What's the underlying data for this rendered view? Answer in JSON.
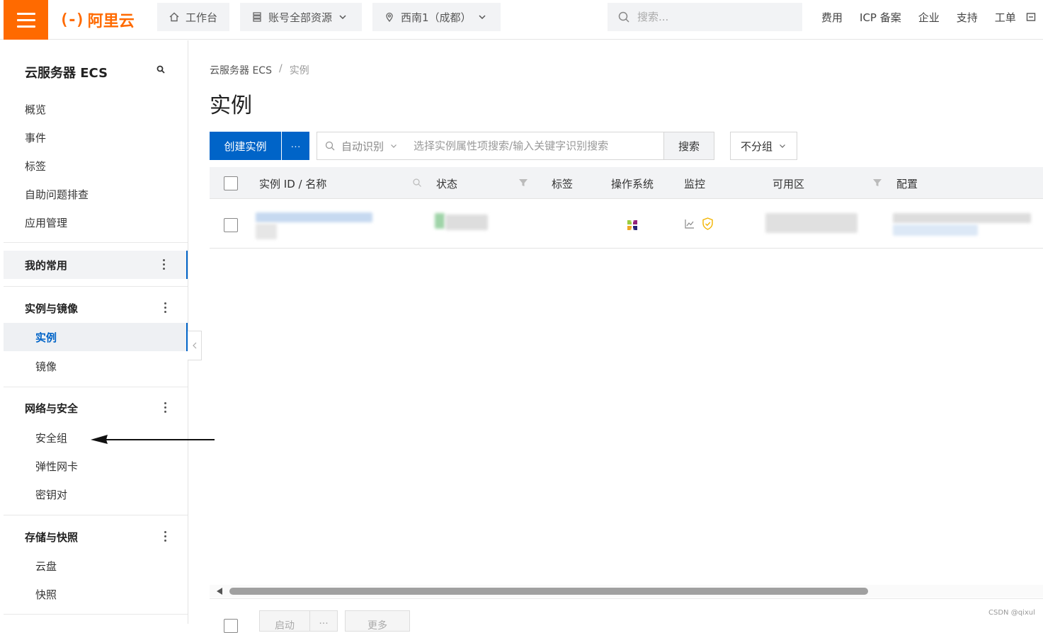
{
  "topbar": {
    "menu_icon": "hamburger-icon",
    "logo_mark": "(-)",
    "logo_text": "阿里云",
    "workbench": "工作台",
    "resources": "账号全部资源",
    "region": "西南1（成都）",
    "search_placeholder": "搜索...",
    "links": [
      "费用",
      "ICP 备案",
      "企业",
      "支持",
      "工单"
    ],
    "accent": "#ff6a00"
  },
  "sidebar": {
    "title": "云服务器 ECS",
    "top_items": [
      "概览",
      "事件",
      "标签",
      "自助问题排查",
      "应用管理"
    ],
    "favorites": "我的常用",
    "groups": {
      "instances_images": {
        "label": "实例与镜像",
        "items": [
          "实例",
          "镜像"
        ]
      },
      "network_security": {
        "label": "网络与安全",
        "items": [
          "安全组",
          "弹性网卡",
          "密钥对"
        ]
      },
      "storage_snapshots": {
        "label": "存储与快照",
        "items": [
          "云盘",
          "快照"
        ]
      }
    },
    "active_item": "实例",
    "active_color": "#0064c8"
  },
  "main": {
    "breadcrumb": [
      "云服务器 ECS",
      "/",
      "实例"
    ],
    "title": "实例",
    "create_button": "创建实例",
    "more_button": "···",
    "filter_auto": "自动识别",
    "filter_placeholder": "选择实例属性项搜索/输入关键字识别搜索",
    "search_button": "搜索",
    "group_button": "不分组",
    "columns": [
      "实例 ID / 名称",
      "状态",
      "标签",
      "操作系统",
      "监控",
      "可用区",
      "配置"
    ],
    "bottom_buttons": [
      "启动",
      "···",
      "更多"
    ]
  },
  "watermark": "CSDN @qixul"
}
